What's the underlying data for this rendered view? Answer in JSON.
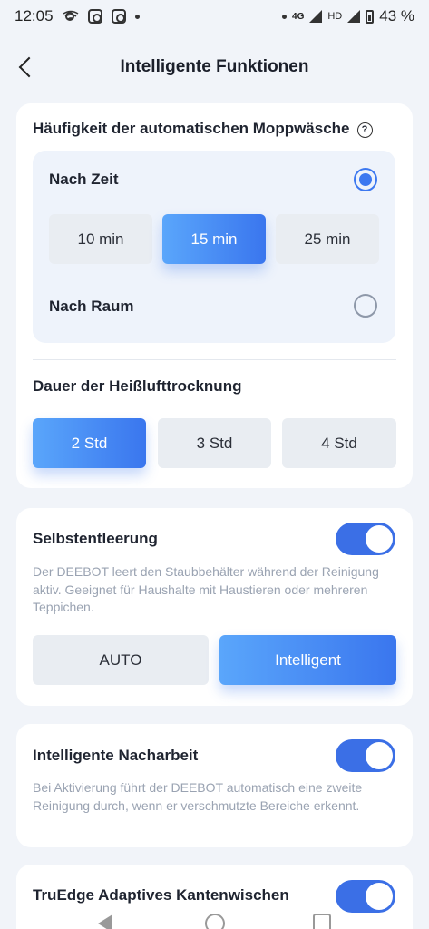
{
  "status_bar": {
    "time": "12:05",
    "network": "4G",
    "hd": "HD",
    "battery": "43 %",
    "icons": [
      "cast-icon",
      "instagram-icon",
      "instagram-icon",
      "dot-icon",
      "signal-icon",
      "wifi-icon",
      "battery-icon"
    ]
  },
  "header": {
    "title": "Intelligente Funktionen"
  },
  "mop_wash": {
    "title": "Häufigkeit der automatischen Moppwäsche",
    "help_symbol": "?",
    "by_time_label": "Nach Zeit",
    "by_time_selected": true,
    "intervals": [
      {
        "label": "10  min",
        "selected": false
      },
      {
        "label": "15  min",
        "selected": true
      },
      {
        "label": "25  min",
        "selected": false
      }
    ],
    "by_room_label": "Nach Raum",
    "by_room_selected": false
  },
  "drying": {
    "title": "Dauer der Heißlufttrocknung",
    "options": [
      {
        "label": "2 Std",
        "selected": true
      },
      {
        "label": "3 Std",
        "selected": false
      },
      {
        "label": "4 Std",
        "selected": false
      }
    ]
  },
  "self_empty": {
    "title": "Selbstentleerung",
    "enabled": true,
    "description": "Der DEEBOT leert den Staubbehälter während der Reinigung aktiv. Geeignet für Haushalte mit Haustieren oder mehreren Teppichen.",
    "modes": [
      {
        "label": "AUTO",
        "selected": false
      },
      {
        "label": "Intelligent",
        "selected": true
      }
    ]
  },
  "rework": {
    "title": "Intelligente Nacharbeit",
    "enabled": true,
    "description": "Bei Aktivierung führt der DEEBOT automatisch eine zweite Reinigung durch, wenn er verschmutzte Bereiche erkennt."
  },
  "truedge": {
    "title": "TruEdge Adaptives Kantenwischen",
    "enabled": true
  },
  "colors": {
    "accent": "#3b6fe6",
    "accent_light": "#5aa6fb",
    "background": "#f1f4f9",
    "card": "#ffffff",
    "description_text": "#9aa3b2"
  }
}
